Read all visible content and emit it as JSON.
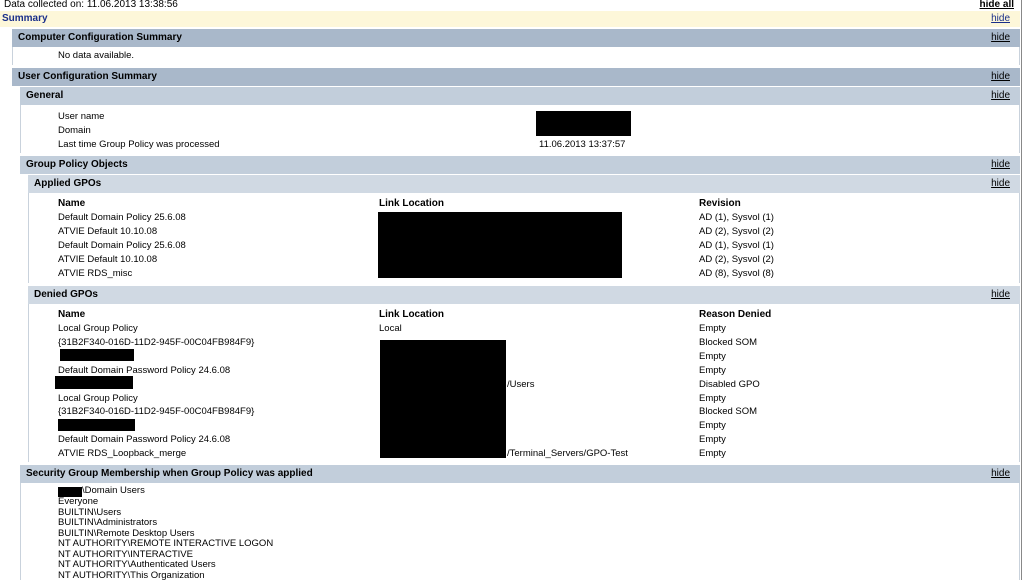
{
  "top": {
    "collected": "Data collected on: 11.06.2013 13:38:56",
    "hide_all": "hide all"
  },
  "summary": {
    "title": "Summary",
    "hide": "hide"
  },
  "computer_config": {
    "title": "Computer Configuration Summary",
    "hide": "hide",
    "no_data": "No data available."
  },
  "user_config": {
    "title": "User Configuration Summary",
    "hide": "hide"
  },
  "general": {
    "title": "General",
    "hide": "hide",
    "rows": [
      {
        "label": "User name",
        "value": ""
      },
      {
        "label": "Domain",
        "value": ""
      },
      {
        "label": "Last time Group Policy was processed",
        "value": "11.06.2013 13:37:57"
      }
    ]
  },
  "gpo": {
    "title": "Group Policy Objects",
    "hide": "hide"
  },
  "applied": {
    "title": "Applied GPOs",
    "hide": "hide",
    "headers": [
      "Name",
      "Link Location",
      "Revision"
    ],
    "rows": [
      {
        "name": "Default Domain Policy 25.6.08",
        "location": "",
        "revision": "AD (1), Sysvol (1)"
      },
      {
        "name": "ATVIE Default 10.10.08",
        "location": "",
        "revision": "AD (2), Sysvol (2)"
      },
      {
        "name": "Default Domain Policy 25.6.08",
        "location": "",
        "revision": "AD (1), Sysvol (1)"
      },
      {
        "name": "ATVIE Default 10.10.08",
        "location": "",
        "revision": "AD (2), Sysvol (2)"
      },
      {
        "name": "ATVIE RDS_misc",
        "location": "",
        "revision": "AD (8), Sysvol (8)"
      }
    ]
  },
  "denied": {
    "title": "Denied GPOs",
    "hide": "hide",
    "headers": [
      "Name",
      "Link Location",
      "Reason Denied"
    ],
    "rows": [
      {
        "name": "Local Group Policy",
        "location": "Local",
        "reason": "Empty"
      },
      {
        "name": "{31B2F340-016D-11D2-945F-00C04FB984F9}",
        "location": "",
        "reason": "Blocked SOM"
      },
      {
        "name": "",
        "location": "",
        "reason": "Empty"
      },
      {
        "name": "Default Domain Password Policy 24.6.08",
        "location": "",
        "reason": "Empty"
      },
      {
        "name": "",
        "location": "/Users",
        "reason": "Disabled GPO"
      },
      {
        "name": "Local Group Policy",
        "location": "",
        "reason": "Empty"
      },
      {
        "name": "{31B2F340-016D-11D2-945F-00C04FB984F9}",
        "location": "",
        "reason": "Blocked SOM"
      },
      {
        "name": "",
        "location": "",
        "reason": "Empty"
      },
      {
        "name": "Default Domain Password Policy 24.6.08",
        "location": "",
        "reason": "Empty"
      },
      {
        "name": "ATVIE RDS_Loopback_merge",
        "location": "/Terminal_Servers/GPO-Test",
        "reason": "Empty"
      }
    ]
  },
  "security": {
    "title": "Security Group Membership when Group Policy was applied",
    "hide": "hide",
    "groups": [
      "\\Domain Users",
      "Everyone",
      "BUILTIN\\Users",
      "BUILTIN\\Administrators",
      "BUILTIN\\Remote Desktop Users",
      "NT AUTHORITY\\REMOTE INTERACTIVE LOGON",
      "NT AUTHORITY\\INTERACTIVE",
      "NT AUTHORITY\\Authenticated Users",
      "NT AUTHORITY\\This Organization"
    ]
  }
}
